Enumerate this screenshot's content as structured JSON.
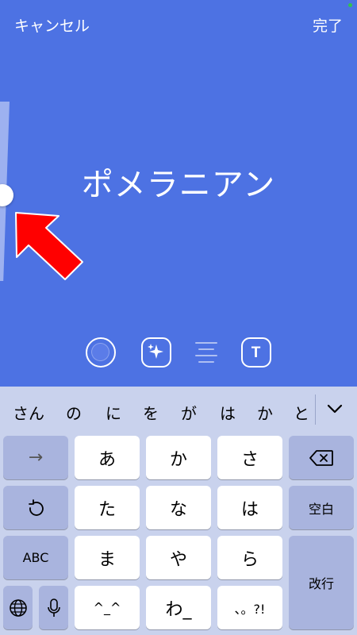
{
  "header": {
    "cancel_label": "キャンセル",
    "done_label": "完了"
  },
  "canvas": {
    "text": "ポメラニアン"
  },
  "toolbar": {
    "tools": [
      "color-icon",
      "effect-icon",
      "align-icon",
      "font-icon"
    ],
    "font_icon_label": "T"
  },
  "suggestions": [
    "さん",
    "の",
    "に",
    "を",
    "が",
    "は",
    "か",
    "と"
  ],
  "keyboard": {
    "arrow": "→",
    "a": "あ",
    "ka": "か",
    "sa": "さ",
    "ta": "た",
    "na": "な",
    "ha": "は",
    "ma": "ま",
    "ya": "や",
    "ra": "ら",
    "emoticon": "^_^",
    "wa": "わ_",
    "punct": "、。?!",
    "space": "空白",
    "abc": "ABC",
    "return": "改行"
  },
  "colors": {
    "editor_bg": "#4d72e3",
    "keyboard_bg": "#c9d2ed",
    "annotation_arrow": "#ff0000"
  }
}
